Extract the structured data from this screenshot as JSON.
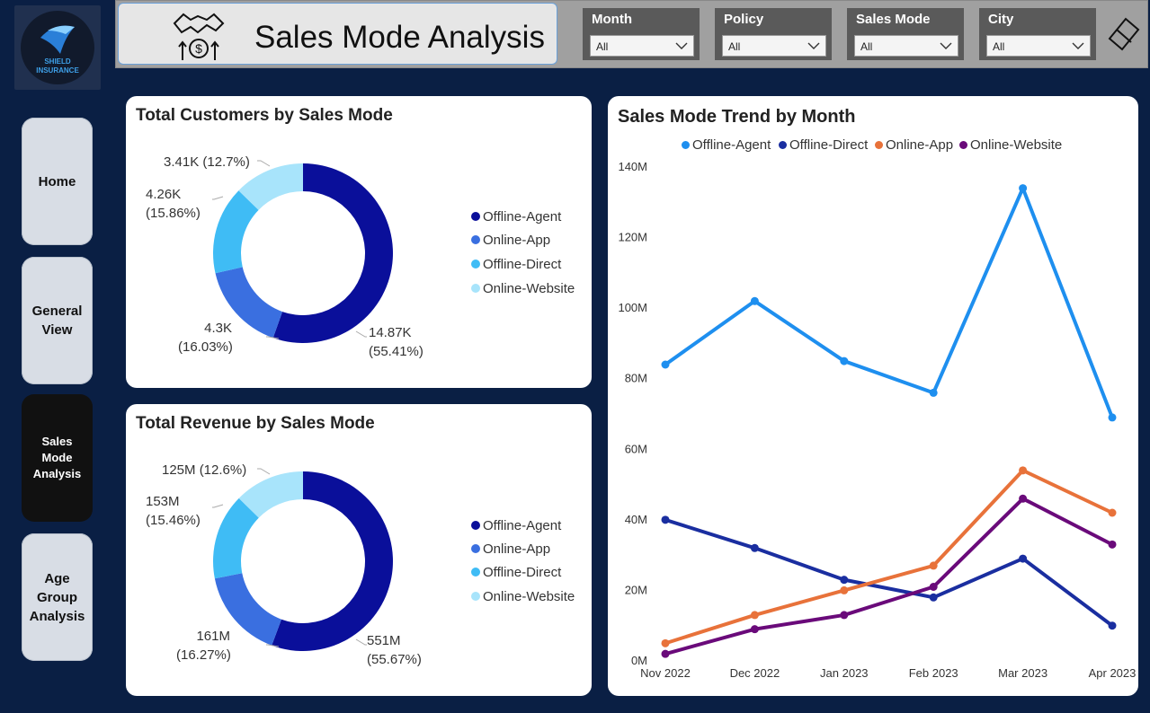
{
  "brand": {
    "logo_text_1": "SHIELD",
    "logo_text_2": "INSURANCE"
  },
  "header": {
    "title": "Sales Mode Analysis",
    "icon": "handshake-money-icon"
  },
  "filters": [
    {
      "label": "Month",
      "value": "All"
    },
    {
      "label": "Policy",
      "value": "All"
    },
    {
      "label": "Sales Mode",
      "value": "All"
    },
    {
      "label": "City",
      "value": "All"
    }
  ],
  "nav": {
    "home": "Home",
    "general_1": "General",
    "general_2": "View",
    "sales_1": "Sales",
    "sales_2": "Mode",
    "sales_3": "Analysis",
    "age_1": "Age",
    "age_2": "Group",
    "age_3": "Analysis"
  },
  "colors": {
    "offline_agent_donut": "#0a0f9a",
    "online_app_donut": "#3a6fe0",
    "offline_direct_donut": "#3fbcf5",
    "online_website_donut": "#a8e4fb",
    "line_offline_agent": "#1e8fef",
    "line_offline_direct": "#1a2ea0",
    "line_online_app": "#e8723a",
    "line_online_website": "#6a0a7a"
  },
  "customers": {
    "title": "Total Customers by Sales Mode",
    "labels": {
      "agent_1": "14.87K",
      "agent_2": "(55.41%)",
      "app_1": "4.3K",
      "app_2": "(16.03%)",
      "direct_1": "4.26K",
      "direct_2": "(15.86%)",
      "website": "3.41K (12.7%)"
    },
    "legend": [
      "Offline-Agent",
      "Online-App",
      "Offline-Direct",
      "Online-Website"
    ]
  },
  "revenue": {
    "title": "Total Revenue by Sales Mode",
    "labels": {
      "agent_1": "551M",
      "agent_2": "(55.67%)",
      "app_1": "161M",
      "app_2": "(16.27%)",
      "direct_1": "153M",
      "direct_2": "(15.46%)",
      "website": "125M (12.6%)"
    },
    "legend": [
      "Offline-Agent",
      "Online-App",
      "Offline-Direct",
      "Online-Website"
    ]
  },
  "trend": {
    "title": "Sales Mode Trend by Month",
    "legend": [
      "Offline-Agent",
      "Offline-Direct",
      "Online-App",
      "Online-Website"
    ]
  },
  "chart_data": [
    {
      "type": "pie",
      "title": "Total Customers by Sales Mode",
      "categories": [
        "Offline-Agent",
        "Online-App",
        "Offline-Direct",
        "Online-Website"
      ],
      "values": [
        14870,
        4300,
        4260,
        3410
      ],
      "percent": [
        55.41,
        16.03,
        15.86,
        12.7
      ],
      "legend": "right"
    },
    {
      "type": "pie",
      "title": "Total Revenue by Sales Mode",
      "categories": [
        "Offline-Agent",
        "Online-App",
        "Offline-Direct",
        "Online-Website"
      ],
      "values": [
        551,
        161,
        153,
        125
      ],
      "percent": [
        55.67,
        16.27,
        15.46,
        12.6
      ],
      "legend": "right"
    },
    {
      "type": "line",
      "title": "Sales Mode Trend by Month",
      "categories": [
        "Nov 2022",
        "Dec 2022",
        "Jan 2023",
        "Feb 2023",
        "Mar 2023",
        "Apr 2023"
      ],
      "yticks": [
        "0M",
        "20M",
        "40M",
        "60M",
        "80M",
        "100M",
        "120M",
        "140M"
      ],
      "ylim": [
        0,
        140
      ],
      "legend": "top",
      "series": [
        {
          "name": "Offline-Agent",
          "values": [
            84,
            102,
            85,
            76,
            134,
            69
          ]
        },
        {
          "name": "Offline-Direct",
          "values": [
            40,
            32,
            23,
            18,
            29,
            10
          ]
        },
        {
          "name": "Online-App",
          "values": [
            5,
            13,
            20,
            27,
            54,
            42
          ]
        },
        {
          "name": "Online-Website",
          "values": [
            2,
            9,
            13,
            21,
            46,
            33
          ]
        }
      ]
    }
  ]
}
